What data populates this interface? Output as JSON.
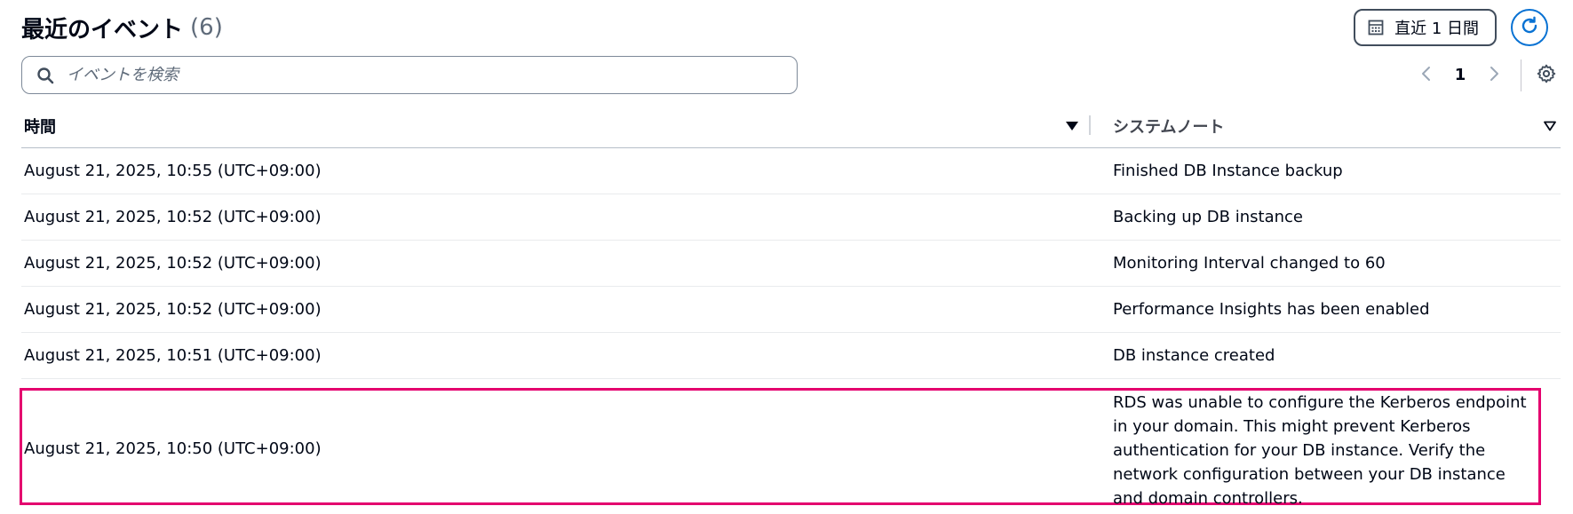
{
  "header": {
    "title": "最近のイベント",
    "count": "(6)",
    "range_label": "直近 1 日間"
  },
  "search": {
    "placeholder": "イベントを検索",
    "value": ""
  },
  "pagination": {
    "current_page": "1"
  },
  "table": {
    "columns": [
      {
        "label": "時間"
      },
      {
        "label": "システムノート"
      }
    ],
    "rows": [
      {
        "time": "August 21, 2025, 10:55 (UTC+09:00)",
        "note": "Finished DB Instance backup"
      },
      {
        "time": "August 21, 2025, 10:52 (UTC+09:00)",
        "note": "Backing up DB instance"
      },
      {
        "time": "August 21, 2025, 10:52 (UTC+09:00)",
        "note": "Monitoring Interval changed to 60"
      },
      {
        "time": "August 21, 2025, 10:52 (UTC+09:00)",
        "note": "Performance Insights has been enabled"
      },
      {
        "time": "August 21, 2025, 10:51 (UTC+09:00)",
        "note": "DB instance created"
      },
      {
        "time": "August 21, 2025, 10:50 (UTC+09:00)",
        "note": "RDS was unable to configure the Kerberos endpoint in your domain. This might prevent Kerberos authentication for your DB instance. Verify the network configuration between your DB instance and domain controllers."
      }
    ]
  },
  "colors": {
    "accent": "#0972d3",
    "highlight": "#e4006e",
    "text": "#000716",
    "muted": "#5f6b7a"
  },
  "icons": {
    "range": "calendar-icon",
    "refresh": "refresh-icon",
    "search": "search-icon",
    "prev": "chevron-left-icon",
    "next": "chevron-right-icon",
    "settings": "gear-icon",
    "sort_active": "caret-down-filled-icon",
    "sort_inactive": "caret-down-outline-icon"
  }
}
